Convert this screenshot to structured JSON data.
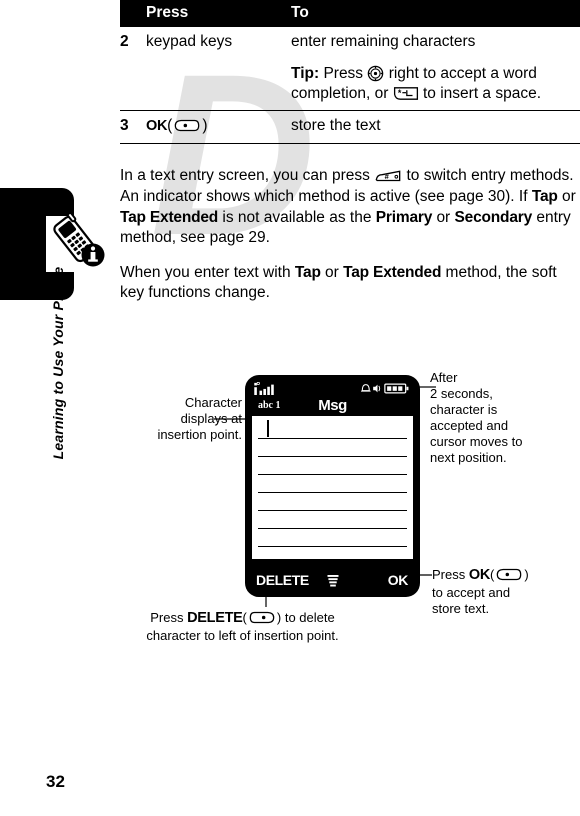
{
  "page": {
    "number": "32",
    "sidebar_title": "Learning to Use Your Phone",
    "watermark": "D"
  },
  "table": {
    "headers": {
      "num": "",
      "press": "Press",
      "to": "To"
    },
    "rows": [
      {
        "num": "2",
        "press": "keypad keys",
        "to": "enter remaining characters"
      },
      {
        "num": "",
        "press": "",
        "tip_label": "Tip:",
        "tip_text_1": "Press",
        "tip_text_2": "right to accept a word completion, or",
        "tip_text_3": "to insert a space."
      },
      {
        "num": "3",
        "press_key": "OK",
        "press_paren_open": "(",
        "press_paren_close": ")",
        "to": "store the text"
      }
    ]
  },
  "paragraphs": {
    "p1_a": "In a text entry screen, you can press",
    "p1_b": "to switch entry methods. An indicator shows which method is active (see page 30). If",
    "p1_tap": "Tap",
    "p1_or": "or",
    "p1_tapext": "Tap Extended",
    "p1_c": "is not available as the",
    "p1_primary": "Primary",
    "p1_or2": "or",
    "p1_secondary": "Secondary",
    "p1_d": "entry method, see page 29.",
    "p2_a": "When you enter text with",
    "p2_tap": "Tap",
    "p2_or": "or",
    "p2_tapext": "Tap Extended",
    "p2_b": "method, the soft key functions change."
  },
  "figure": {
    "phone": {
      "mode_indicator": "abc 1",
      "title": "Msg",
      "softkey_left": "DELETE",
      "softkey_right": "OK",
      "softkey_center_icon": "menu-icon",
      "status_icons": [
        "signal-strength-icon",
        "alarm-icon",
        "ringer-icon",
        "battery-icon"
      ],
      "line_count": 8
    },
    "callouts": {
      "left": {
        "l1": "Character",
        "l2": "displays at",
        "l3": "insertion point."
      },
      "right_top": {
        "l1": "After",
        "l2": "2 seconds,",
        "l3": "character is",
        "l4": "accepted and",
        "l5": "cursor moves to",
        "l6": "next position."
      },
      "right_bottom": {
        "press": "Press",
        "key": "OK",
        "paren_open": "(",
        "paren_close": ")",
        "l2": "to accept and",
        "l3": "store text."
      },
      "bottom": {
        "press": "Press",
        "key": "DELETE",
        "paren_open": "(",
        "paren_close": ")",
        "suffix": "to delete",
        "l2": "character to left of insertion point."
      }
    }
  },
  "colors": {
    "ink": "#000000",
    "paper": "#ffffff",
    "watermark": "#e2e2e2"
  }
}
